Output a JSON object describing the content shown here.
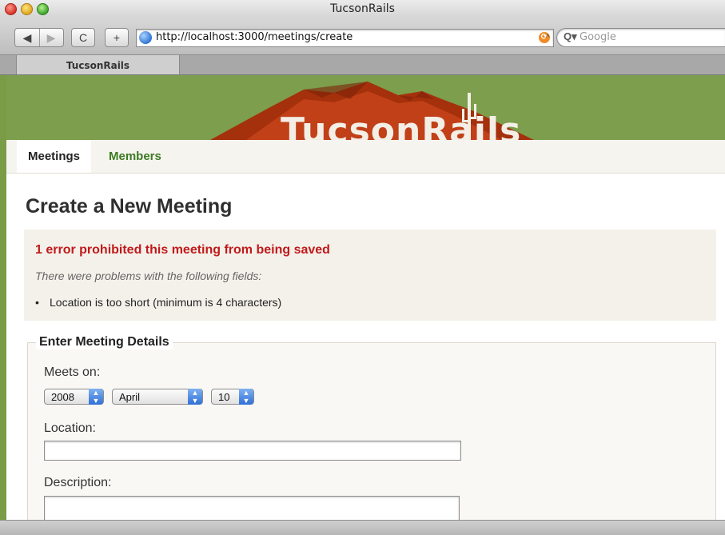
{
  "window": {
    "title": "TucsonRails"
  },
  "toolbar": {
    "back_icon": "◀",
    "forward_icon": "▶",
    "reload_icon": "C",
    "add_icon": "+",
    "url": "http://localhost:3000/meetings/create",
    "rss_icon": "rss-icon",
    "search_placeholder": "Google"
  },
  "tabs": [
    {
      "label": "TucsonRails"
    }
  ],
  "site": {
    "logo": "TucsonRails",
    "nav": [
      {
        "label": "Meetings"
      },
      {
        "label": "Members"
      }
    ],
    "colors": {
      "banner": "#7c9e4d",
      "error_text": "#c11a1a",
      "nav_link": "#3c7a22"
    }
  },
  "page": {
    "heading": "Create a New Meeting",
    "errors": {
      "title": "1 error prohibited this meeting from being saved",
      "subtitle": "There were problems with the following fields:",
      "items": [
        "Location is too short (minimum is 4 characters)"
      ]
    },
    "form": {
      "legend": "Enter Meeting Details",
      "meets_on_label": "Meets on:",
      "year": "2008",
      "month": "April",
      "day": "10",
      "location_label": "Location:",
      "location_value": "",
      "description_label": "Description:",
      "description_value": ""
    }
  }
}
